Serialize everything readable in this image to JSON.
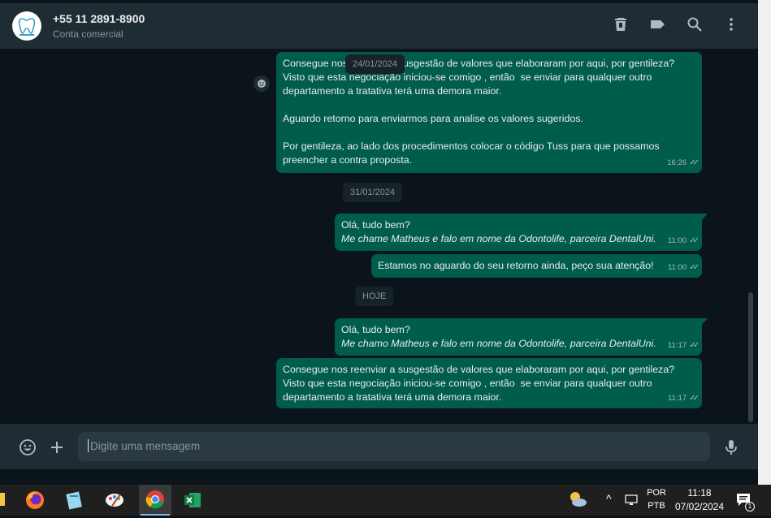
{
  "header": {
    "contact_name": "+55 11 2891-8900",
    "contact_subtitle": "Conta comercial",
    "icons": [
      "delete-icon",
      "label-icon",
      "search-icon",
      "menu-icon"
    ]
  },
  "chat": {
    "messages": [
      {
        "lines": [
          "Consegue nos reenviar a susgestão de valores que elaboraram por aqui, por gentileza?",
          "Visto que esta negociação iniciou-se comigo , então  se enviar para qualquer outro",
          "departamento a tratativa terá uma demora maior.",
          "",
          "Aguardo retorno para enviarmos para analise os valores sugeridos.",
          "",
          "Por gentileza, ao lado dos procedimentos colocar o código Tuss para que possamos",
          "preencher a contra proposta."
        ],
        "time": "16:26"
      },
      {
        "line1": "Olá, tudo bem?",
        "line2": "Me chame Matheus e falo em nome da Odontolife, parceira DentalUni.",
        "time": "11:00"
      },
      {
        "line1": "Estamos no aguardo do seu retorno ainda, peço sua atenção!",
        "time": "11:00"
      },
      {
        "line1": "Olá, tudo bem?",
        "line2": "Me chamo Matheus e falo em nome da Odontolife, parceira DentalUni.",
        "time": "11:17"
      },
      {
        "lines": [
          "Consegue nos reenviar a susgestão de valores que elaboraram por aqui, por gentileza?",
          "Visto que esta negociação iniciou-se comigo , então  se enviar para qualquer outro",
          "departamento a tratativa terá uma demora maior."
        ],
        "time": "11:17"
      }
    ],
    "dates": [
      "24/01/2024",
      "31/01/2024",
      "HOJE"
    ]
  },
  "composer": {
    "placeholder": "Digite uma mensagem"
  },
  "taskbar": {
    "lang_top": "POR",
    "lang_bottom": "PTB",
    "time": "11:18",
    "date": "07/02/2024",
    "notification_count": "1"
  },
  "colors": {
    "outgoing_bubble": "#005c4b",
    "header_bg": "#202c33",
    "chat_bg": "#0b141a"
  }
}
